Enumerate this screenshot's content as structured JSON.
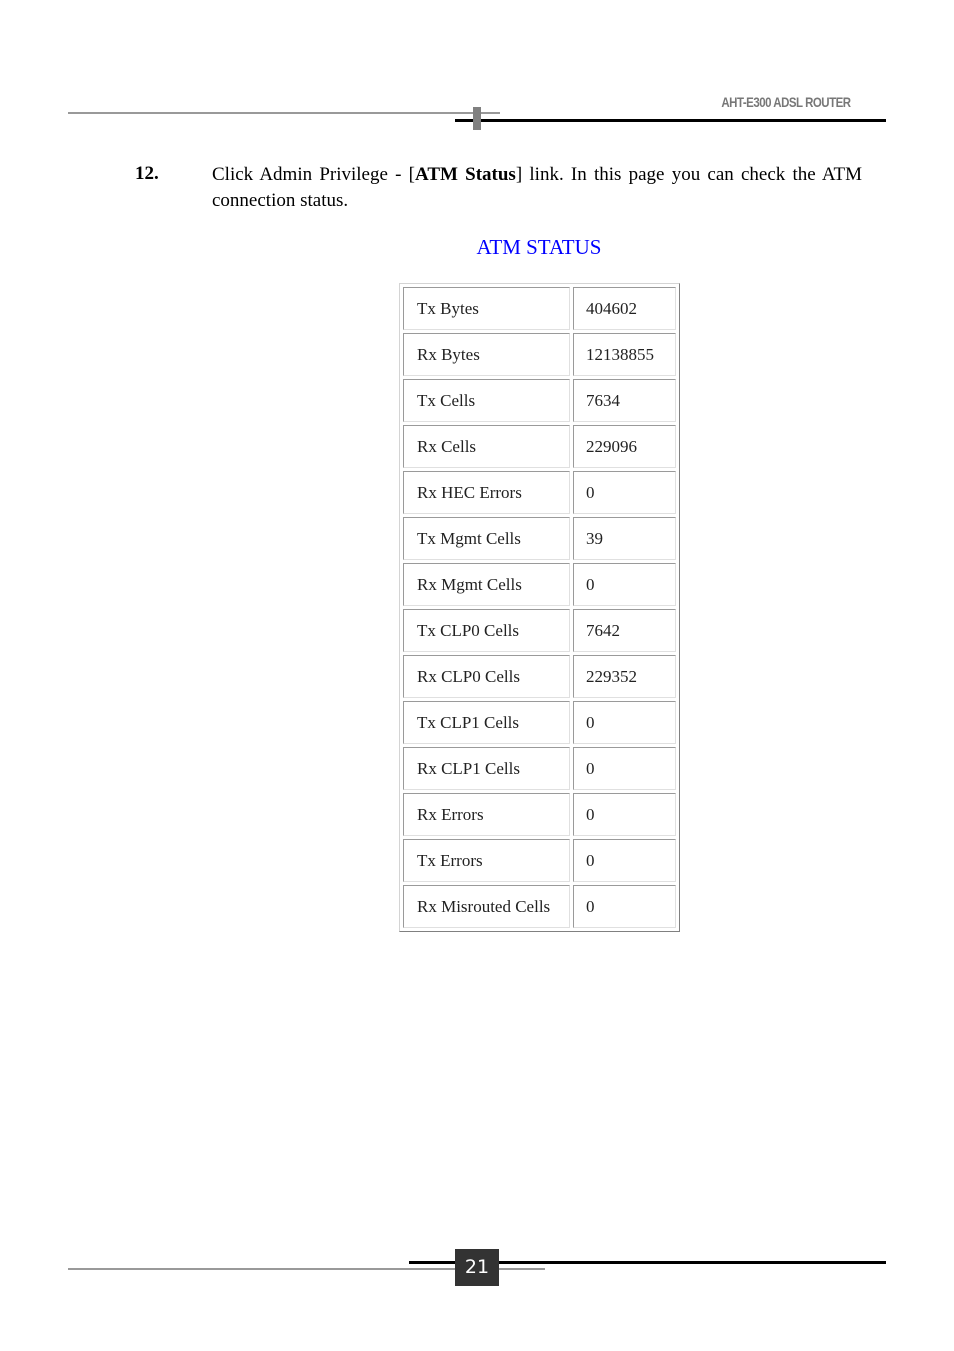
{
  "header": {
    "title": "AHT-E300 ADSL ROUTER"
  },
  "step": {
    "number": "12.",
    "text_before": "Click Admin Privilege - [",
    "bold": "ATM Status",
    "text_after": "] link. In this page you can check the ATM connection status."
  },
  "atm_status": {
    "heading": "ATM STATUS",
    "rows": [
      {
        "label": "Tx Bytes",
        "value": "404602"
      },
      {
        "label": "Rx Bytes",
        "value": "12138855"
      },
      {
        "label": "Tx Cells",
        "value": "7634"
      },
      {
        "label": "Rx Cells",
        "value": "229096"
      },
      {
        "label": "Rx HEC Errors",
        "value": "0"
      },
      {
        "label": "Tx Mgmt Cells",
        "value": "39"
      },
      {
        "label": "Rx Mgmt Cells",
        "value": "0"
      },
      {
        "label": "Tx CLP0 Cells",
        "value": "7642"
      },
      {
        "label": "Rx CLP0 Cells",
        "value": "229352"
      },
      {
        "label": "Tx CLP1 Cells",
        "value": "0"
      },
      {
        "label": "Rx CLP1 Cells",
        "value": "0"
      },
      {
        "label": "Rx Errors",
        "value": "0"
      },
      {
        "label": "Tx Errors",
        "value": "0"
      },
      {
        "label": "Rx Misrouted Cells",
        "value": "0"
      }
    ]
  },
  "footer": {
    "page_number": "21"
  },
  "colors": {
    "heading_blue": "#0000ff",
    "page_number_bg": "#333333",
    "header_title_gray": "#777777"
  }
}
